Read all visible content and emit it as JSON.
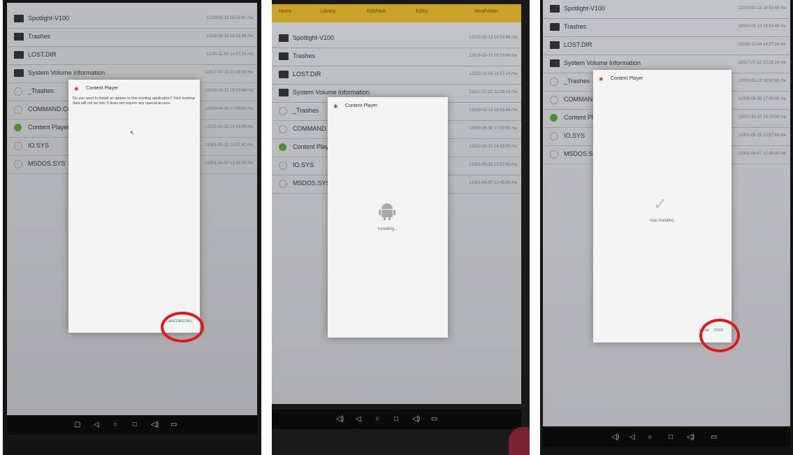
{
  "panels": [
    {
      "topbar_tabs": [],
      "files": [
        {
          "name": "Spotlight-V100",
          "date": "12/19/03-13 16:53:41 /rw",
          "icon": "folder"
        },
        {
          "name": "Trashes",
          "date": "12/19-03-13 16:53:48 /rw",
          "icon": "folder"
        },
        {
          "name": "LOST.DIR",
          "date": "12/20-11-04 14:37:24 /rw",
          "icon": "folder"
        },
        {
          "name": "System Volume Information",
          "date": "12017-07-22 22:28:16 /rw",
          "icon": "folder"
        },
        {
          "name": "_Trashes",
          "date": "12019-03-13 16:53:48 /rw",
          "icon": "circle"
        },
        {
          "name": "COMMAND.COM",
          "date": "12009-06-08 17:00:00 /rw",
          "icon": "circle"
        },
        {
          "name": "Content Player V",
          "date": "12022-10-10 14:13:00 /rw",
          "icon": "app"
        },
        {
          "name": "IO.SYS",
          "date": "12001-05-15 12:57:42 /rw",
          "icon": "circle"
        },
        {
          "name": "MSDOS.SYS",
          "date": "12001-04-07 12:45:00 /rw",
          "icon": "circle"
        }
      ],
      "dialog": {
        "title": "Content Player",
        "message": "Do you want to install an update to this existing application? Your existing data will not be lost. It does not require any special access.",
        "center_text": "",
        "buttons": [
          "CANCEL",
          "INSTALL"
        ]
      },
      "nav": [
        "▢",
        "◁",
        "○",
        "□",
        "◁)",
        "▭"
      ]
    },
    {
      "topbar_tabs": [
        "Home",
        "Library",
        "Edit/Mult",
        "Editor",
        "NewFolder"
      ],
      "files": [
        {
          "name": "Spotlight-V100",
          "date": "12019-03-13 16:53:48 /rw",
          "icon": "folder"
        },
        {
          "name": "Trashes",
          "date": "12019-03-13 16:53:48 /rw",
          "icon": "folder"
        },
        {
          "name": "LOST.DIR",
          "date": "12020-11-04 14:37:24 /rw",
          "icon": "folder"
        },
        {
          "name": "System Volume Information",
          "date": "12017-07-22 22:28:16 /rw",
          "icon": "folder"
        },
        {
          "name": "_Trashes",
          "date": "12019-03-13 16:53:48 /rw",
          "icon": "circle"
        },
        {
          "name": "COMMAND.COM",
          "date": "12009-06-08 17:00:00 /rw",
          "icon": "circle"
        },
        {
          "name": "Content Player V",
          "date": "12022-10-10 14:13:00 /rw",
          "icon": "app"
        },
        {
          "name": "IO.SYS",
          "date": "12001-05-15 12:57:42 /rw",
          "icon": "circle"
        },
        {
          "name": "MSDOS.SYS",
          "date": "12001-04-07 12:45:00 /rw",
          "icon": "circle"
        }
      ],
      "dialog": {
        "title": "Content Player",
        "message": "",
        "center_text": "Installing...",
        "buttons": []
      },
      "nav": [
        "◁)",
        "◁",
        "○",
        "□",
        "◁)",
        "▭"
      ]
    },
    {
      "topbar_tabs": [],
      "files": [
        {
          "name": "Spotlight-V100",
          "date": "12019-03-13 16:53:48 /rw",
          "icon": "folder"
        },
        {
          "name": "Trashes",
          "date": "12019-03-13 16:53:48 /rw",
          "icon": "folder"
        },
        {
          "name": "LOST.DIR",
          "date": "12020-11-04 14:37:24 /rw",
          "icon": "folder"
        },
        {
          "name": "System Volume Information",
          "date": "12017-07-22 22:28:16 /rw",
          "icon": "folder"
        },
        {
          "name": "_Trashes",
          "date": "12019-03-13 16:53:48 /rw",
          "icon": "circle"
        },
        {
          "name": "COMMAND.COM",
          "date": "12009-06-08 17:00:00 /rw",
          "icon": "circle"
        },
        {
          "name": "Content Player V",
          "date": "12022-10-10 14:13:00 /rw",
          "icon": "app"
        },
        {
          "name": "IO.SYS",
          "date": "12001-05-15 12:57:42 /rw",
          "icon": "circle"
        },
        {
          "name": "MSDOS.SYS",
          "date": "12001-04-07 12:45:00 /rw",
          "icon": "circle"
        }
      ],
      "dialog": {
        "title": "Content Player",
        "message": "",
        "center_text": "App installed.",
        "buttons": [
          "DONE",
          "OPEN"
        ]
      },
      "nav": [
        "◁)",
        "◁",
        "○",
        "□",
        "◁)",
        "▭"
      ]
    }
  ],
  "colors": {
    "highlight_ring": "#e1161b",
    "topbar": "#c9a227",
    "dialog_bg": "#f4f4f4",
    "button_text": "#2c8a6c"
  }
}
